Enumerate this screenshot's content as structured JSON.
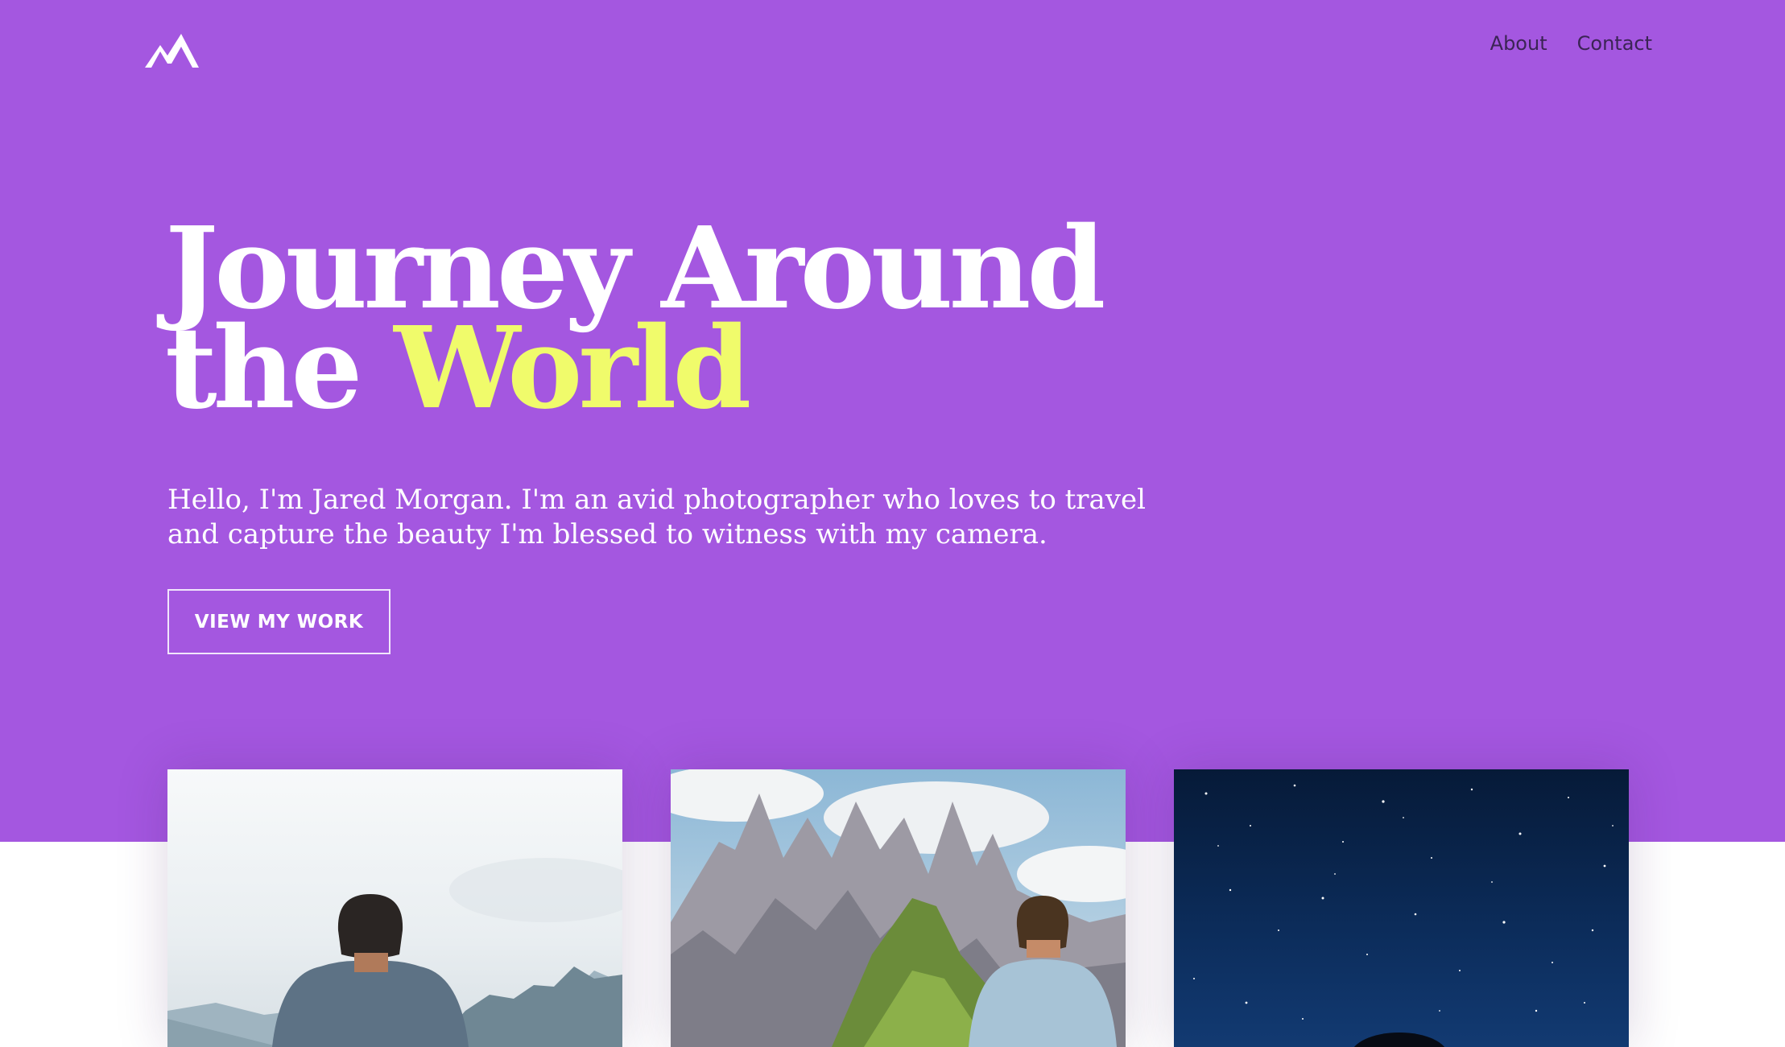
{
  "brand": {
    "logo_icon": "mountain-logo-icon",
    "background_color": "#a457e0",
    "accent_color": "#f0fb6b"
  },
  "nav": {
    "items": [
      {
        "label": "About"
      },
      {
        "label": "Contact"
      }
    ]
  },
  "hero": {
    "headline_line1": "Journey Around",
    "headline_line2_prefix": "the",
    "headline_line2_accent": "World",
    "intro": "Hello, I'm Jared Morgan. I'm an avid photographer who loves to travel and capture the beauty I'm blessed to witness with my camera.",
    "cta_label": "VIEW MY WORK"
  },
  "gallery": {
    "cards": [
      {
        "subject": "man-facing-misty-mountains-photo"
      },
      {
        "subject": "man-facing-rocky-peaks-photo"
      },
      {
        "subject": "starry-night-sky-photo"
      }
    ]
  }
}
